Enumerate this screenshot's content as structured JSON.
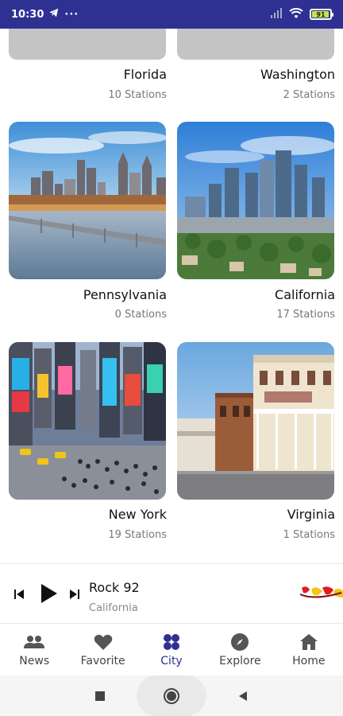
{
  "status_bar": {
    "time": "10:30",
    "more": "···",
    "battery": "91"
  },
  "cities": [
    {
      "name": "Florida",
      "count": "10 Stations",
      "image": "partial-placeholder"
    },
    {
      "name": "Washington",
      "count": "2 Stations",
      "image": "partial-placeholder"
    },
    {
      "name": "Pennsylvania",
      "count": "0 Stations",
      "image": "philadelphia-skyline"
    },
    {
      "name": "California",
      "count": "17 Stations",
      "image": "los-angeles-skyline"
    },
    {
      "name": "New York",
      "count": "19 Stations",
      "image": "times-square"
    },
    {
      "name": "Virginia",
      "count": "1 Stations",
      "image": "old-town-street"
    }
  ],
  "player": {
    "title": "Rock 92",
    "subtitle": "California",
    "controls": [
      "skip-previous-icon",
      "play-icon",
      "skip-next-icon"
    ],
    "logo": "station-logo"
  },
  "nav": {
    "items": [
      {
        "label": "News",
        "icon": "people-icon",
        "active": false
      },
      {
        "label": "Favorite",
        "icon": "heart-icon",
        "active": false
      },
      {
        "label": "City",
        "icon": "grid-icon",
        "active": true
      },
      {
        "label": "Explore",
        "icon": "compass-icon",
        "active": false
      },
      {
        "label": "Home",
        "icon": "home-icon",
        "active": false
      }
    ]
  },
  "colors": {
    "primary": "#2e3192",
    "text": "#111111",
    "muted": "#777777",
    "placeholder": "#c4c4c4"
  }
}
